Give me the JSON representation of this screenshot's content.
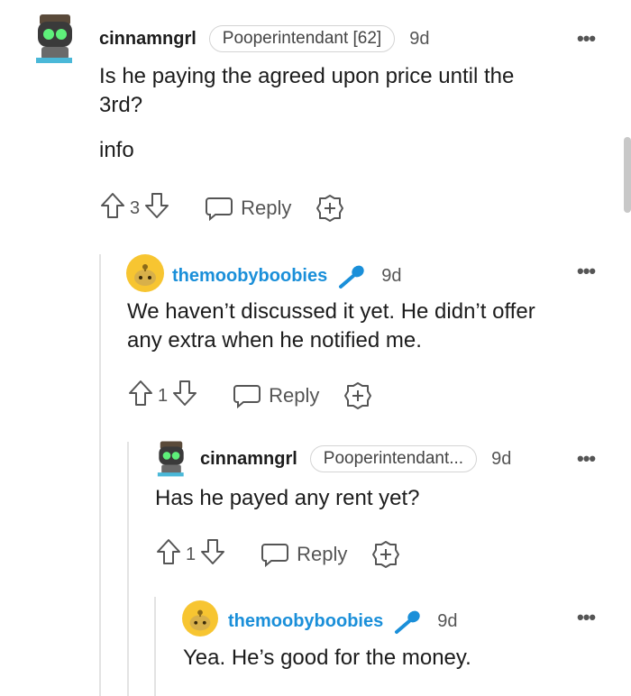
{
  "comments": [
    {
      "username": "cinnamngrl",
      "flair": "Pooperintendant [62]",
      "time": "9d",
      "body": [
        "Is he paying the agreed upon price until the",
        "3rd?",
        "info"
      ],
      "votes": "3",
      "reply": "Reply"
    },
    {
      "username": "themoobyboobies",
      "time": "9d",
      "body": [
        "We haven’t discussed it yet. He didn’t offer",
        "any extra when he notified me."
      ],
      "votes": "1",
      "reply": "Reply"
    },
    {
      "username": "cinnamngrl",
      "flair": "Pooperintendant...",
      "time": "9d",
      "body": [
        "Has he payed any rent yet?"
      ],
      "votes": "1",
      "reply": "Reply"
    },
    {
      "username": "themoobyboobies",
      "time": "9d",
      "body": [
        "Yea. He’s good for the money."
      ]
    }
  ],
  "more_label": "•••",
  "colors": {
    "op_username": "#1a8fd9",
    "text": "#1c1c1c",
    "muted": "#555555"
  }
}
